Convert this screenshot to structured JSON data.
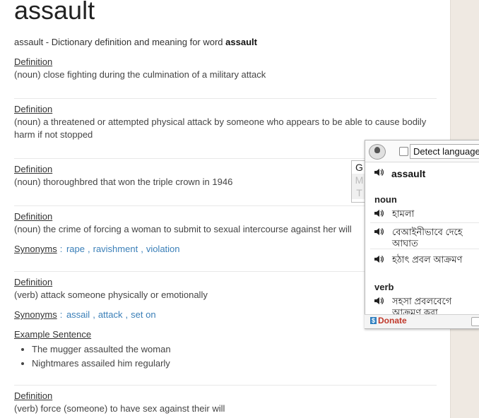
{
  "page": {
    "word": "assault",
    "subtitle_prefix": "assault - Dictionary definition and meaning for word ",
    "subtitle_word": "assault"
  },
  "entries": [
    {
      "label": "Definition",
      "text": "(noun) close fighting during the culmination of a military attack"
    },
    {
      "label": "Definition",
      "text": "(noun) a threatened or attempted physical attack by someone who appears to be able to cause bodily harm if not stopped"
    },
    {
      "label": "Definition",
      "text": "(noun) thoroughbred that won the triple crown in 1946"
    },
    {
      "label": "Definition",
      "text": "(noun) the crime of forcing a woman to submit to sexual intercourse against her will",
      "synonyms_label": "Synonyms",
      "synonyms": [
        "rape",
        "ravishment",
        "violation"
      ]
    },
    {
      "label": "Definition",
      "text": "(verb) attack someone physically or emotionally",
      "synonyms_label": "Synonyms",
      "synonyms": [
        "assail",
        "attack",
        "set on"
      ],
      "example_label": "Example Sentence",
      "examples": [
        "The mugger assaulted the woman",
        "Nightmares assailed him regularly"
      ]
    },
    {
      "label": "Definition",
      "text": "(verb) force (someone) to have sex against their will"
    }
  ],
  "popup": {
    "detect_label": "Detect language",
    "tabs": [
      "G",
      "M",
      "T"
    ],
    "headword": "assault",
    "pos_noun": "noun",
    "noun_translations": [
      "হামলা",
      "বেআইনীভাবে দেহে আঘাত",
      "হঠাৎ প্রবল আক্রমণ"
    ],
    "pos_verb": "verb",
    "verb_translations": [
      "সহসা প্রবলবেগে আক্রমণ করা"
    ],
    "donate_label": "Donate",
    "donate_icon": "$"
  },
  "colors": {
    "link": "#3a7fb8",
    "donate": "#c0392b",
    "right_band": "#efe9e2"
  }
}
